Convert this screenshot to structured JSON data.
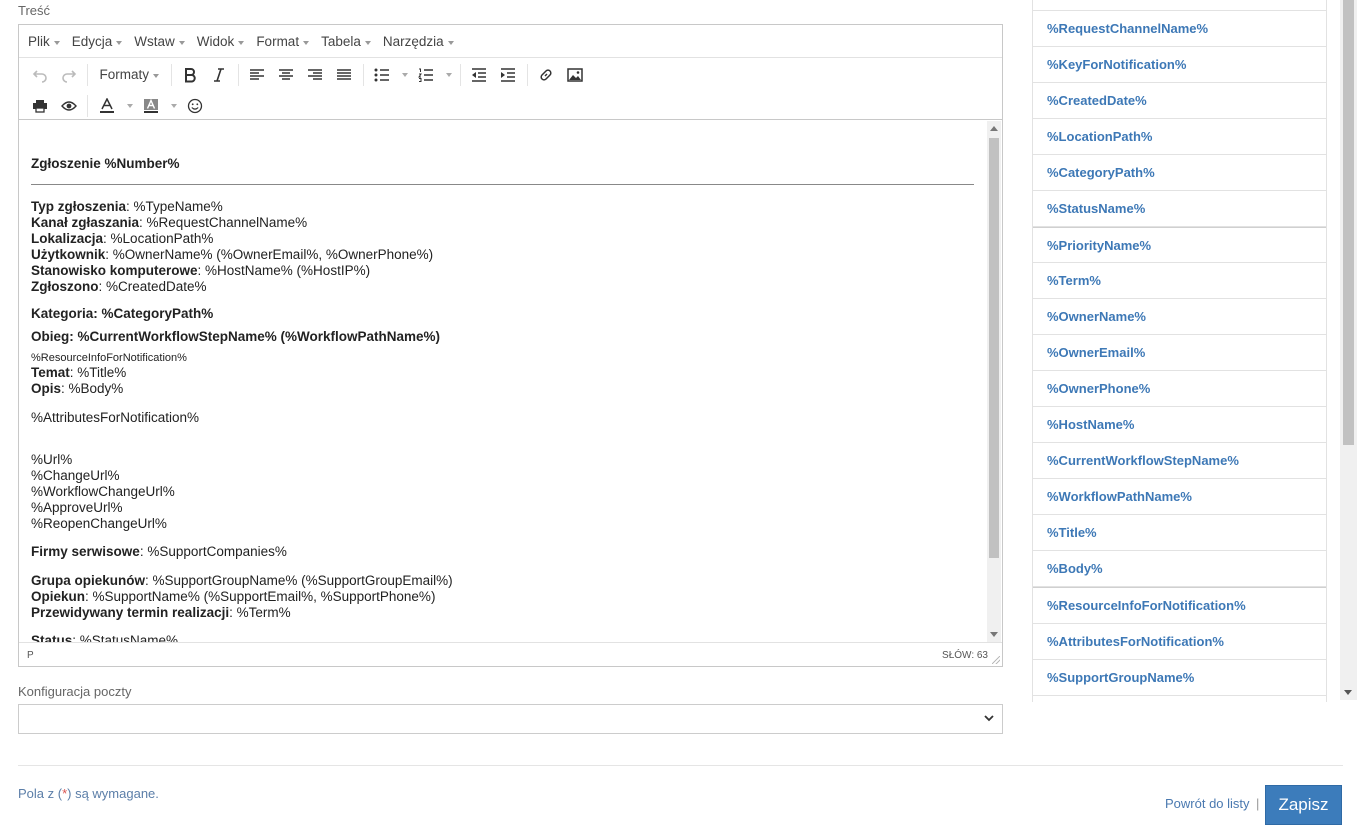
{
  "labels": {
    "content": "Treść",
    "mail_config": "Konfiguracja poczty"
  },
  "menubar": [
    "Plik",
    "Edycja",
    "Wstaw",
    "Widok",
    "Format",
    "Tabela",
    "Narzędzia"
  ],
  "toolbar": {
    "formats": "Formaty"
  },
  "document": {
    "heading": "Zgłoszenie %Number%",
    "type_label": "Typ zgłoszenia",
    "type_value": ": %TypeName%",
    "channel_label": "Kanał zgłaszania",
    "channel_value": ": %RequestChannelName%",
    "location_label": "Lokalizacja",
    "location_value": ": %LocationPath%",
    "user_label": "Użytkownik",
    "user_value": ": %OwnerName% (%OwnerEmail%, %OwnerPhone%)",
    "host_label": "Stanowisko komputerowe",
    "host_value": ": %HostName% (%HostIP%)",
    "created_label": "Zgłoszono",
    "created_value": ": %CreatedDate%",
    "category": "Kategoria: %CategoryPath%",
    "workflow": "Obieg: %CurrentWorkflowStepName% (%WorkflowPathName%)",
    "resource_info": "%ResourceInfoForNotification%",
    "title_label": "Temat",
    "title_value": ": %Title%",
    "body_label": "Opis",
    "body_value": ": %Body%",
    "attributes": "%AttributesForNotification%",
    "urls": [
      "%Url%",
      "%ChangeUrl%",
      "%WorkflowChangeUrl%",
      "%ApproveUrl%",
      "%ReopenChangeUrl%"
    ],
    "companies_label": "Firmy serwisowe",
    "companies_value": ": %SupportCompanies%",
    "group_label": "Grupa opiekunów",
    "group_value": ": %SupportGroupName% (%SupportGroupEmail%)",
    "support_label": "Opiekun",
    "support_value": ": %SupportName% (%SupportEmail%, %SupportPhone%)",
    "term_label": "Przewidywany termin realizacji",
    "term_value": ": %Term%",
    "status_label": "Status",
    "status_value": ": %StatusName%"
  },
  "statusbar": {
    "path": "P",
    "words": "SŁÓW: 63"
  },
  "footer": {
    "required_prefix": "Pola z (",
    "required_star": "*",
    "required_suffix": ") są wymagane.",
    "back_link": "Powrót do listy",
    "pipe": "|",
    "save": "Zapisz"
  },
  "variables": [
    "%RequestChannelName%",
    "%KeyForNotification%",
    "%CreatedDate%",
    "%LocationPath%",
    "%CategoryPath%",
    "%StatusName%",
    "%PriorityName%",
    "%Term%",
    "%OwnerName%",
    "%OwnerEmail%",
    "%OwnerPhone%",
    "%HostName%",
    "%CurrentWorkflowStepName%",
    "%WorkflowPathName%",
    "%Title%",
    "%Body%",
    "%ResourceInfoForNotification%",
    "%AttributesForNotification%",
    "%SupportGroupName%"
  ],
  "colors": {
    "accent": "#3c7cbb",
    "link": "#3d78b6",
    "required_star": "#d9534f"
  }
}
